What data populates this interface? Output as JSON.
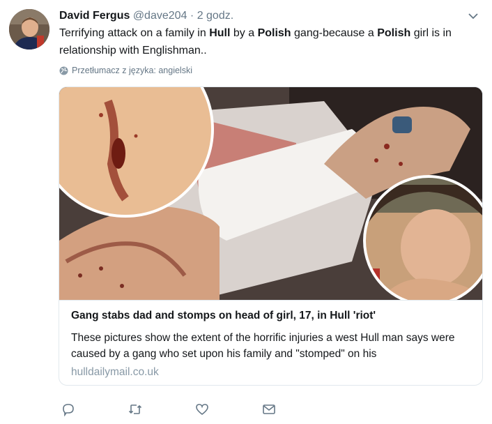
{
  "tweet": {
    "author_name": "David Fergus",
    "handle": "@dave204",
    "separator": "·",
    "time": "2 godz.",
    "text_parts": [
      "Terrifying attack on a family in ",
      "Hull",
      " by a ",
      "Polish",
      " gang-because a ",
      "Polish",
      " girl is in relationship with Englishman.."
    ],
    "translate_label": "Przetłumacz z języka: angielski"
  },
  "card": {
    "title": "Gang stabs dad and stomps on head of girl, 17, in Hull 'riot'",
    "description": "These pictures show the extent of the horrific injuries a west Hull man says were caused by a gang who set upon his family and \"stomped\" on his",
    "domain": "hulldailymail.co.uk"
  },
  "icons": {
    "caret": "chevron-down-icon",
    "globe": "globe-icon",
    "reply": "reply-icon",
    "retweet": "retweet-icon",
    "like": "heart-icon",
    "dm": "envelope-icon"
  },
  "colors": {
    "text": "#14171a",
    "secondary": "#657786",
    "border": "#e1e8ed",
    "domain": "#8899a6"
  }
}
